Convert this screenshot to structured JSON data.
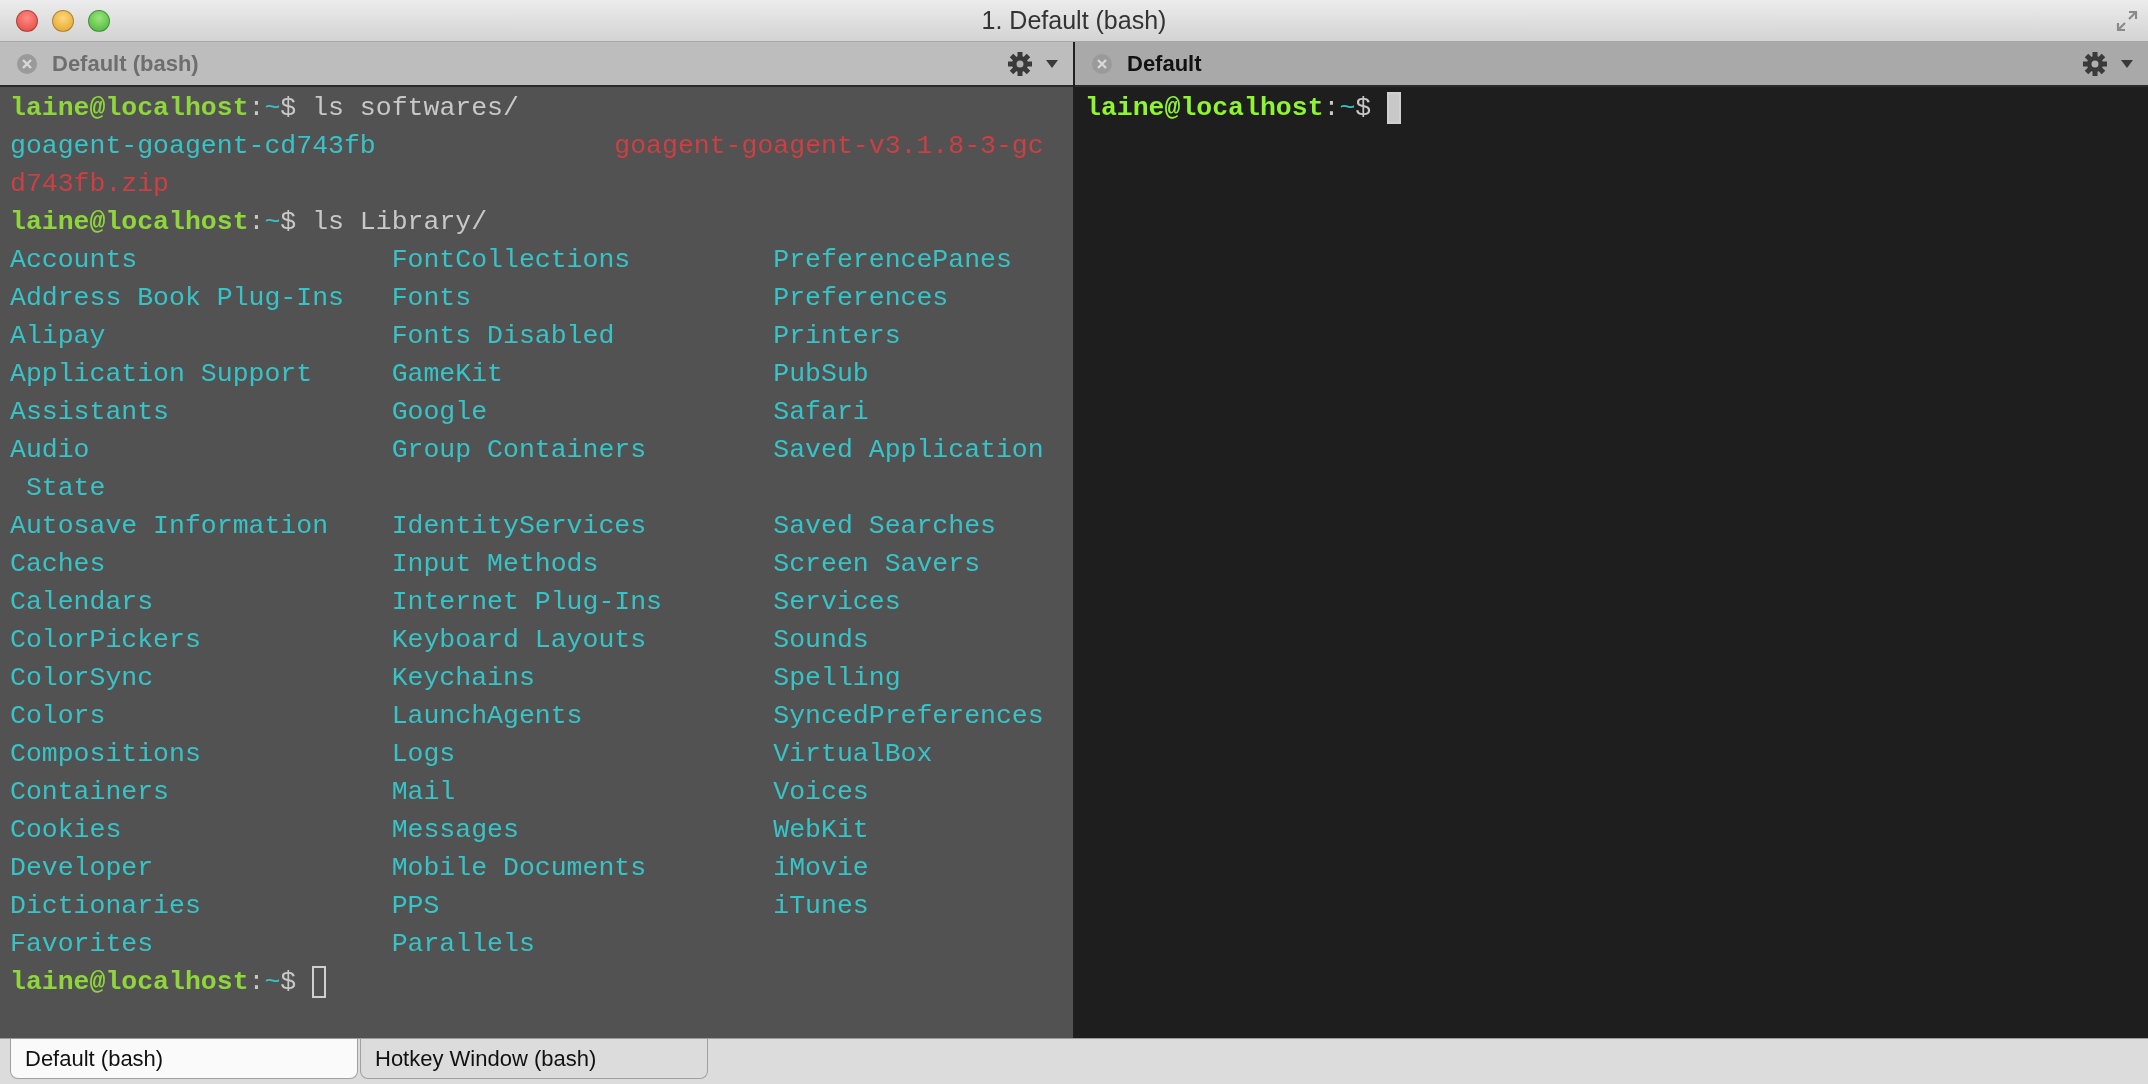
{
  "window": {
    "title": "1. Default (bash)"
  },
  "panes": [
    {
      "title": "Default (bash)",
      "active": false,
      "lines": [
        {
          "kind": "prompt",
          "user": "laine@localhost",
          "separator": ":",
          "path": "~",
          "symbol": "$",
          "command": "ls softwares/",
          "cursor": false
        },
        {
          "kind": "wide_columns",
          "cells": [
            {
              "text": "goagent-goagent-cd743fb",
              "kind": "dir"
            },
            {
              "text": "goagent-goagent-v3.1.8-3-gc",
              "kind": "archive"
            }
          ]
        },
        {
          "kind": "columns",
          "cells": [
            {
              "text": "d743fb.zip",
              "kind": "archive"
            }
          ]
        },
        {
          "kind": "prompt",
          "user": "laine@localhost",
          "separator": ":",
          "path": "~",
          "symbol": "$",
          "command": "ls Library/",
          "cursor": false
        },
        {
          "kind": "columns",
          "cells": [
            {
              "text": "Accounts",
              "kind": "dir"
            },
            {
              "text": "FontCollections",
              "kind": "dir"
            },
            {
              "text": "PreferencePanes",
              "kind": "dir"
            }
          ]
        },
        {
          "kind": "columns",
          "cells": [
            {
              "text": "Address Book Plug-Ins",
              "kind": "dir"
            },
            {
              "text": "Fonts",
              "kind": "dir"
            },
            {
              "text": "Preferences",
              "kind": "dir"
            }
          ]
        },
        {
          "kind": "columns",
          "cells": [
            {
              "text": "Alipay",
              "kind": "dir"
            },
            {
              "text": "Fonts Disabled",
              "kind": "dir"
            },
            {
              "text": "Printers",
              "kind": "dir"
            }
          ]
        },
        {
          "kind": "columns",
          "cells": [
            {
              "text": "Application Support",
              "kind": "dir"
            },
            {
              "text": "GameKit",
              "kind": "dir"
            },
            {
              "text": "PubSub",
              "kind": "dir"
            }
          ]
        },
        {
          "kind": "columns",
          "cells": [
            {
              "text": "Assistants",
              "kind": "dir"
            },
            {
              "text": "Google",
              "kind": "dir"
            },
            {
              "text": "Safari",
              "kind": "dir"
            }
          ]
        },
        {
          "kind": "columns",
          "cells": [
            {
              "text": "Audio",
              "kind": "dir"
            },
            {
              "text": "Group Containers",
              "kind": "dir"
            },
            {
              "text": "Saved Application",
              "kind": "dir"
            }
          ]
        },
        {
          "kind": "columns",
          "cells": [
            {
              "text": " State",
              "kind": "dir"
            }
          ]
        },
        {
          "kind": "columns",
          "cells": [
            {
              "text": "Autosave Information",
              "kind": "dir"
            },
            {
              "text": "IdentityServices",
              "kind": "dir"
            },
            {
              "text": "Saved Searches",
              "kind": "dir"
            }
          ]
        },
        {
          "kind": "columns",
          "cells": [
            {
              "text": "Caches",
              "kind": "dir"
            },
            {
              "text": "Input Methods",
              "kind": "dir"
            },
            {
              "text": "Screen Savers",
              "kind": "dir"
            }
          ]
        },
        {
          "kind": "columns",
          "cells": [
            {
              "text": "Calendars",
              "kind": "dir"
            },
            {
              "text": "Internet Plug-Ins",
              "kind": "dir"
            },
            {
              "text": "Services",
              "kind": "dir"
            }
          ]
        },
        {
          "kind": "columns",
          "cells": [
            {
              "text": "ColorPickers",
              "kind": "dir"
            },
            {
              "text": "Keyboard Layouts",
              "kind": "dir"
            },
            {
              "text": "Sounds",
              "kind": "dir"
            }
          ]
        },
        {
          "kind": "columns",
          "cells": [
            {
              "text": "ColorSync",
              "kind": "dir"
            },
            {
              "text": "Keychains",
              "kind": "dir"
            },
            {
              "text": "Spelling",
              "kind": "dir"
            }
          ]
        },
        {
          "kind": "columns",
          "cells": [
            {
              "text": "Colors",
              "kind": "dir"
            },
            {
              "text": "LaunchAgents",
              "kind": "dir"
            },
            {
              "text": "SyncedPreferences",
              "kind": "dir"
            }
          ]
        },
        {
          "kind": "columns",
          "cells": [
            {
              "text": "Compositions",
              "kind": "dir"
            },
            {
              "text": "Logs",
              "kind": "dir"
            },
            {
              "text": "VirtualBox",
              "kind": "dir"
            }
          ]
        },
        {
          "kind": "columns",
          "cells": [
            {
              "text": "Containers",
              "kind": "dir"
            },
            {
              "text": "Mail",
              "kind": "dir"
            },
            {
              "text": "Voices",
              "kind": "dir"
            }
          ]
        },
        {
          "kind": "columns",
          "cells": [
            {
              "text": "Cookies",
              "kind": "dir"
            },
            {
              "text": "Messages",
              "kind": "dir"
            },
            {
              "text": "WebKit",
              "kind": "dir"
            }
          ]
        },
        {
          "kind": "columns",
          "cells": [
            {
              "text": "Developer",
              "kind": "dir"
            },
            {
              "text": "Mobile Documents",
              "kind": "dir"
            },
            {
              "text": "iMovie",
              "kind": "dir"
            }
          ]
        },
        {
          "kind": "columns",
          "cells": [
            {
              "text": "Dictionaries",
              "kind": "dir"
            },
            {
              "text": "PPS",
              "kind": "dir"
            },
            {
              "text": "iTunes",
              "kind": "dir"
            }
          ]
        },
        {
          "kind": "columns",
          "cells": [
            {
              "text": "Favorites",
              "kind": "dir"
            },
            {
              "text": "Parallels",
              "kind": "dir"
            }
          ]
        },
        {
          "kind": "prompt",
          "user": "laine@localhost",
          "separator": ":",
          "path": "~",
          "symbol": "$",
          "cursor": true
        }
      ]
    },
    {
      "title": "Default",
      "active": true,
      "lines": [
        {
          "kind": "prompt",
          "user": "laine@localhost",
          "separator": ":",
          "path": "~",
          "symbol": "$",
          "cursor": true
        }
      ]
    }
  ],
  "tabs": [
    {
      "label": "Default (bash)",
      "selected": true
    },
    {
      "label": "Hotkey Window (bash)",
      "selected": false
    }
  ]
}
